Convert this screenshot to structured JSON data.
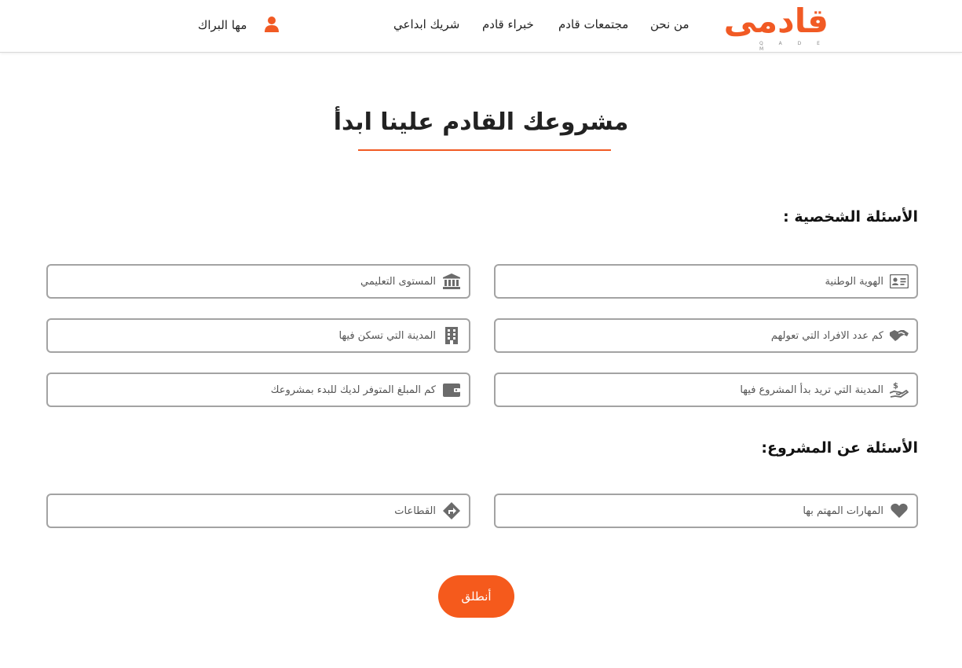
{
  "header": {
    "logo_text": "قادمى",
    "logo_sub": "Q A D E M",
    "nav": [
      "من نحن",
      "مجتمعات قادم",
      "خبراء قادم",
      "شريك ابداعي"
    ],
    "user_name": "مها البراك"
  },
  "main": {
    "title": "مشروعك القادم علينا ابدأ",
    "personal_heading": "الأسئلة الشخصية :",
    "project_heading": "الأسئلة عن المشروع:",
    "fields": {
      "national_id": {
        "placeholder": "الهوية الوطنية",
        "icon": "id-card-icon"
      },
      "education": {
        "placeholder": "المستوى التعليمي",
        "icon": "institution-icon"
      },
      "dependents": {
        "placeholder": "كم عدد الافراد التي تعولهم",
        "icon": "handshake-icon"
      },
      "city_live": {
        "placeholder": "المدينة التي تسكن فيها",
        "icon": "building-icon"
      },
      "city_project": {
        "placeholder": "المدينة التي تريد بدأ المشروع فيها",
        "icon": "hand-holding-dollar-icon"
      },
      "budget": {
        "placeholder": "كم المبلغ المتوفر لديك للبدء بمشروعك",
        "icon": "wallet-icon"
      },
      "skills": {
        "placeholder": "المهارات المهتم بها",
        "icon": "heart-icon"
      },
      "sectors": {
        "placeholder": "القطاعات",
        "icon": "directions-icon"
      }
    },
    "submit_label": "أنطلق"
  },
  "colors": {
    "accent": "#f15a24",
    "button": "#f55a1c",
    "border": "#a3a3a3",
    "icon": "#6b6b6b"
  }
}
